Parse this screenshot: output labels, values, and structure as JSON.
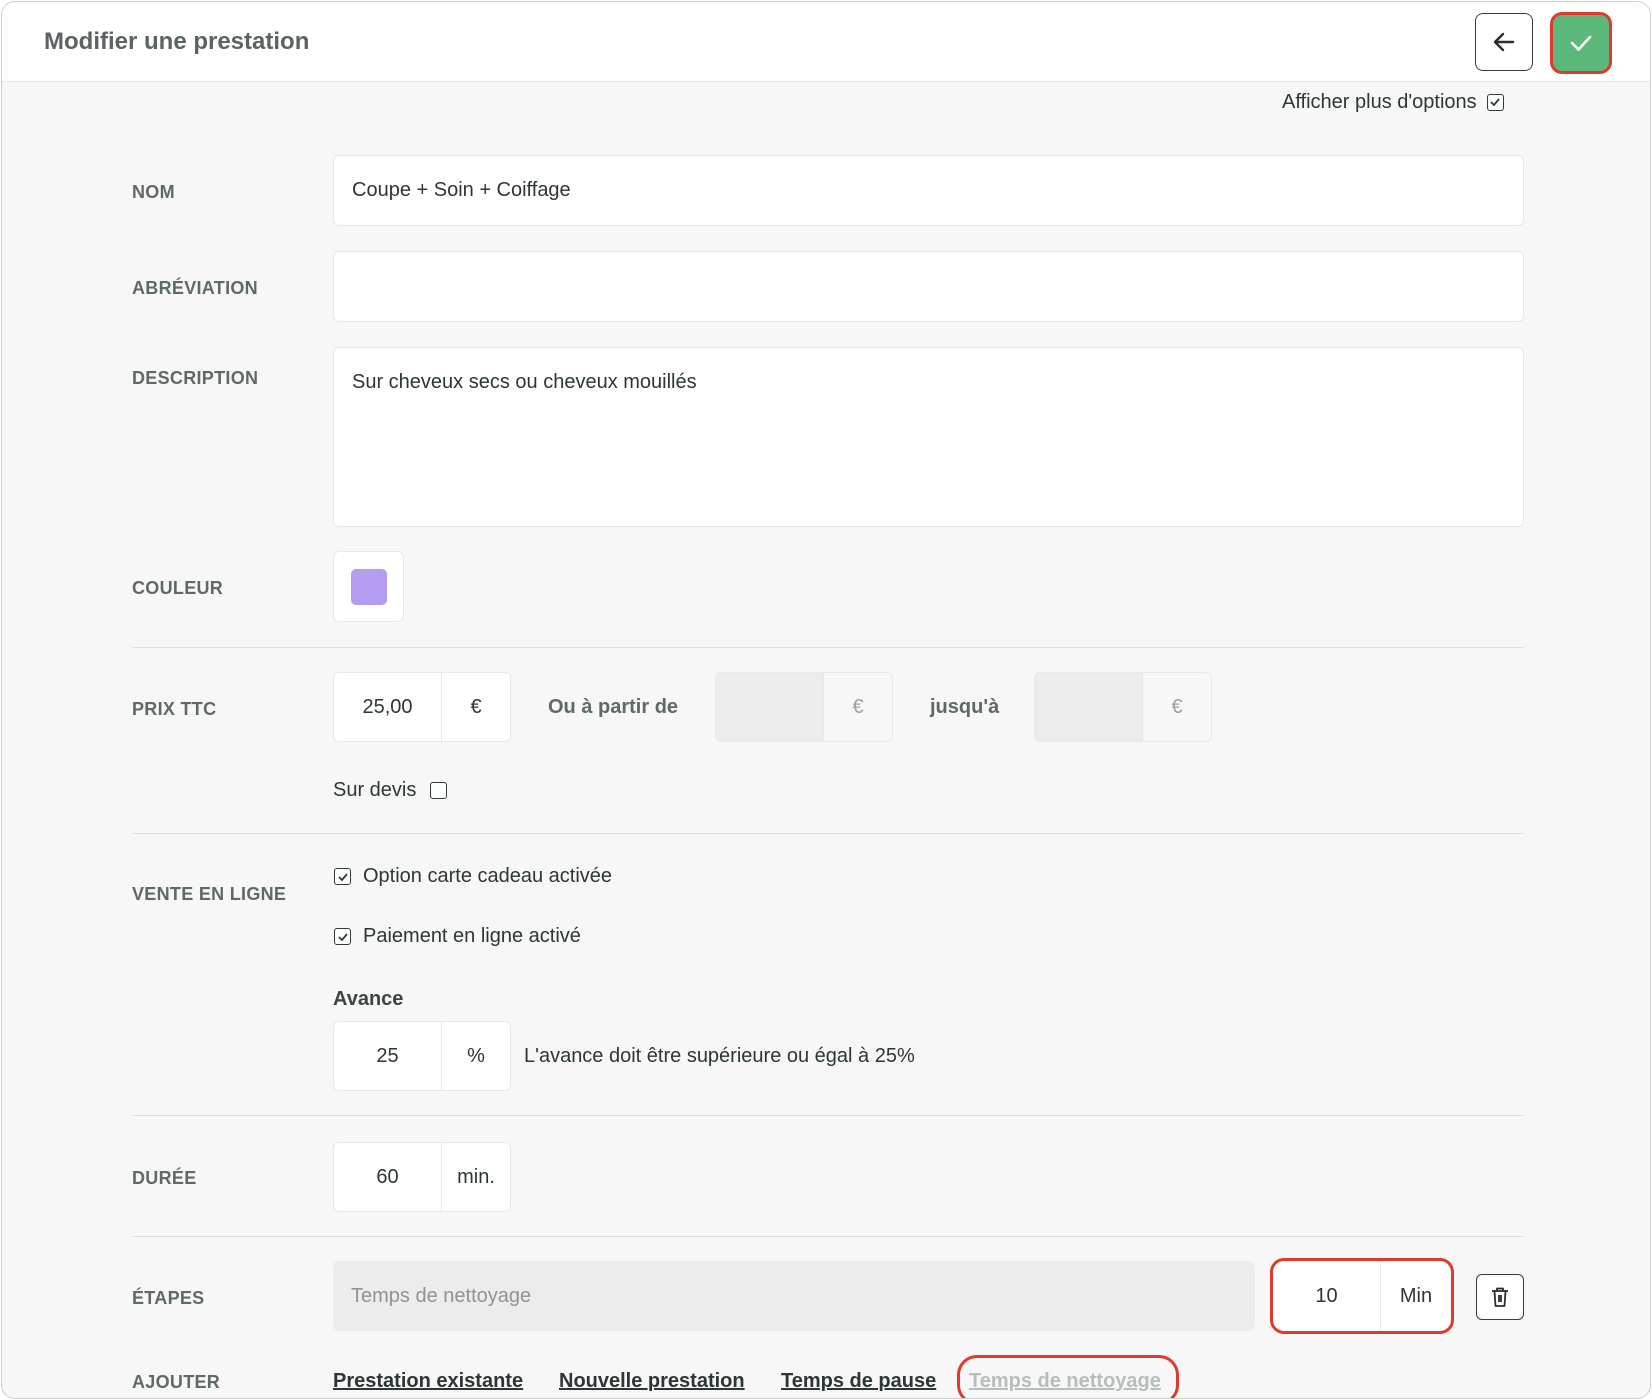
{
  "header": {
    "title": "Modifier une prestation",
    "back_icon": "arrow-left-icon",
    "save_icon": "check-icon"
  },
  "options": {
    "more_label": "Afficher plus d'options",
    "more_checked": true
  },
  "form": {
    "nom": {
      "label": "NOM",
      "value": "Coupe + Soin + Coiffage"
    },
    "abreviation": {
      "label": "ABRÉVIATION",
      "value": ""
    },
    "description": {
      "label": "DESCRIPTION",
      "value": "Sur cheveux secs ou cheveux mouillés"
    },
    "couleur": {
      "label": "COULEUR",
      "value": "#b49cf0"
    },
    "prix": {
      "label": "PRIX TTC",
      "value": "25,00",
      "currency": "€",
      "from_label": "Ou à partir de",
      "from_value": "",
      "from_currency": "€",
      "to_label": "jusqu'à",
      "to_value": "",
      "to_currency": "€",
      "devis_label": "Sur devis",
      "devis_checked": false
    },
    "vente": {
      "label": "VENTE EN LIGNE",
      "gift_label": "Option carte cadeau activée",
      "gift_checked": true,
      "payment_label": "Paiement en ligne activé",
      "payment_checked": true,
      "advance_title": "Avance",
      "advance_value": "25",
      "advance_unit": "%",
      "advance_note": "L'avance doit être supérieure ou égal à 25%"
    },
    "duree": {
      "label": "DURÉE",
      "value": "60",
      "unit": "min."
    },
    "etapes": {
      "label": "ÉTAPES",
      "step_placeholder": "Temps de nettoyage",
      "step_duration": "10",
      "step_unit": "Min",
      "trash_icon": "trash-icon"
    },
    "ajouter": {
      "label": "AJOUTER",
      "links": [
        "Prestation existante",
        "Nouvelle prestation",
        "Temps de pause",
        "Temps de nettoyage"
      ]
    }
  },
  "colors": {
    "accent_green": "#5cb87a",
    "highlight_red": "#e03a2a"
  }
}
